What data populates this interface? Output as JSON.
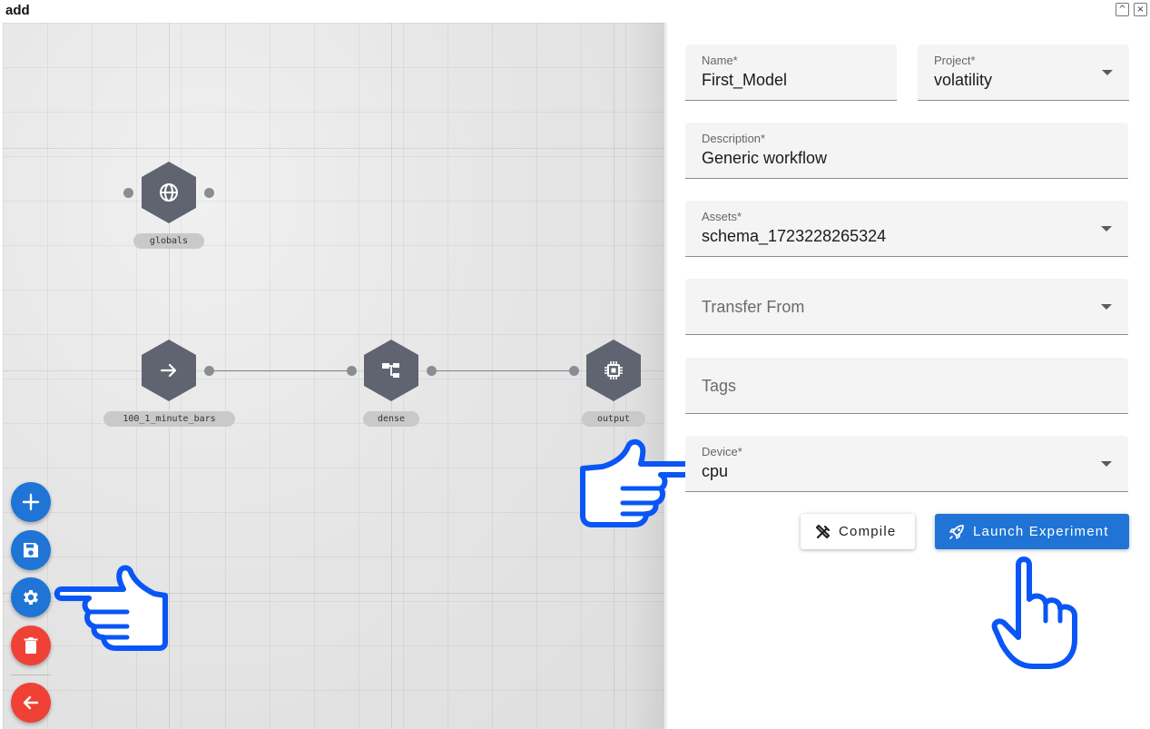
{
  "window": {
    "title": "add",
    "maximize_glyph": "^",
    "close_glyph": "×"
  },
  "graph": {
    "nodes": [
      {
        "id": "globals",
        "label": "globals",
        "icon": "globe-icon"
      },
      {
        "id": "bars",
        "label": "100_1_minute_bars",
        "icon": "arrow-right-icon"
      },
      {
        "id": "dense",
        "label": "dense",
        "icon": "hierarchy-icon"
      },
      {
        "id": "output",
        "label": "output",
        "icon": "chip-icon"
      }
    ]
  },
  "toolbar": {
    "add_icon": "plus-icon",
    "save_icon": "floppy-disk-icon",
    "settings_icon": "gear-icon",
    "delete_icon": "trash-icon",
    "back_icon": "arrow-left-icon"
  },
  "form": {
    "name": {
      "label": "Name*",
      "value": "First_Model"
    },
    "project": {
      "label": "Project*",
      "value": "volatility"
    },
    "description": {
      "label": "Description*",
      "value": "Generic workflow"
    },
    "assets": {
      "label": "Assets*",
      "value": "schema_1723228265324"
    },
    "transfer_from": {
      "placeholder": "Transfer From"
    },
    "tags": {
      "placeholder": "Tags"
    },
    "device": {
      "label": "Device*",
      "value": "cpu"
    }
  },
  "actions": {
    "compile_label": "Compile",
    "compile_icon": "tools-icon",
    "launch_label": "Launch Experiment",
    "launch_icon": "rocket-icon"
  },
  "colors": {
    "primary": "#1f74d6",
    "danger": "#ef4136",
    "node": "#5f6470",
    "pointer": "#0a55f5"
  }
}
